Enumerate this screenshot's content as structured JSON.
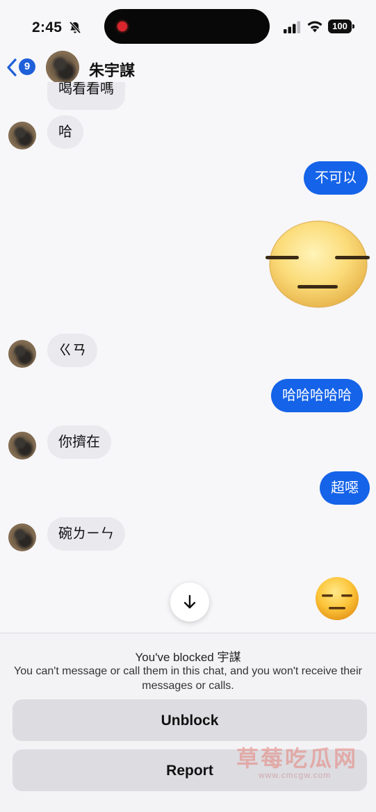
{
  "status_bar": {
    "time": "2:45",
    "battery": "100",
    "icons": [
      "bell-slash-icon",
      "signal-icon",
      "wifi-icon",
      "battery-icon"
    ]
  },
  "header": {
    "back_icon": "chevron-left-icon",
    "unread_count": "9",
    "contact_name": "朱宇謀"
  },
  "messages": [
    {
      "side": "in",
      "text": "喝看看嗎",
      "partial": true
    },
    {
      "side": "in",
      "text": "哈"
    },
    {
      "side": "out",
      "text": "不可以"
    },
    {
      "side": "out",
      "emoji": "expressionless-face-icon"
    },
    {
      "side": "in",
      "text": "ㄍㄢ"
    },
    {
      "side": "out",
      "text": "哈哈哈哈哈"
    },
    {
      "side": "in",
      "text": "你擠在"
    },
    {
      "side": "out",
      "text": "超噁"
    },
    {
      "side": "in",
      "text": "碗ㄌㄧㄣ"
    },
    {
      "side": "out",
      "emoji": "expressionless-face-icon"
    }
  ],
  "scroll_button_icon": "arrow-down-icon",
  "block_notice": {
    "title": "You've blocked 宇謀",
    "description": "You can't message or call them in this chat, and you won't receive their messages or calls."
  },
  "buttons": {
    "unblock": "Unblock",
    "report": "Report"
  },
  "watermark": {
    "text": "草莓吃瓜网",
    "url": "www.cmcgw.com"
  },
  "colors": {
    "outgoing_bubble": "#1563e8",
    "incoming_bubble": "#e9e9ee",
    "badge": "#1f5fd9"
  }
}
